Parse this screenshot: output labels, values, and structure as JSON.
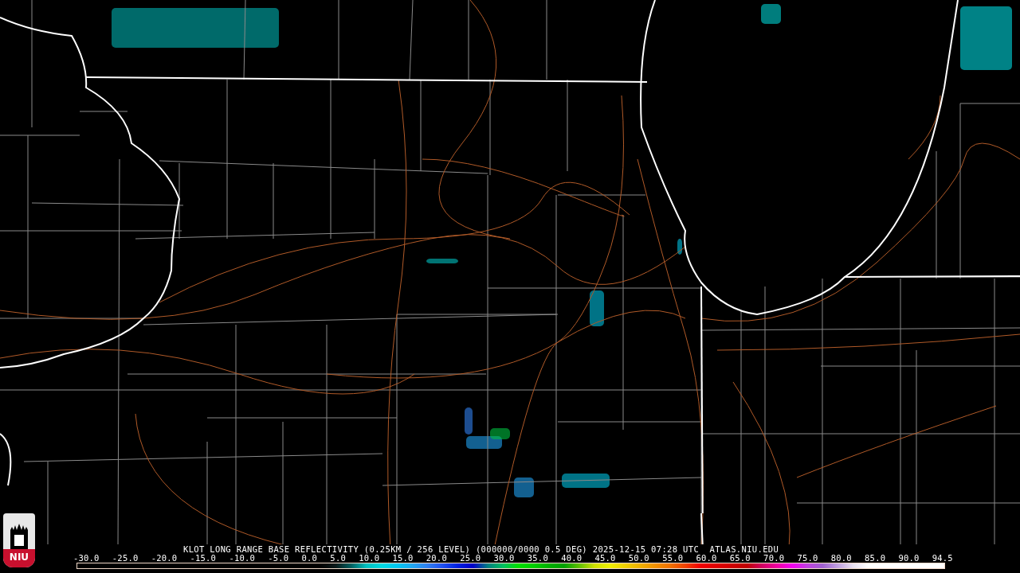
{
  "logo": {
    "text": "NIU"
  },
  "product_title": "KLOT LONG RANGE BASE REFLECTIVITY (0.25KM / 256 LEVEL) (000000/0000 0.5 DEG) 2025-12-15 07:28 UTC  ATLAS.NIU.EDU",
  "legend_ticks": [
    "-30.0",
    "-25.0",
    "-20.0",
    "-15.0",
    "-10.0",
    "-5.0",
    "0.0",
    "5.0",
    "10.0",
    "15.0",
    "20.0",
    "25.0",
    "30.0",
    "35.0",
    "40.0",
    "45.0",
    "50.0",
    "55.0",
    "60.0",
    "65.0",
    "70.0",
    "75.0",
    "80.0",
    "85.0",
    "90.0",
    "94.5"
  ]
}
